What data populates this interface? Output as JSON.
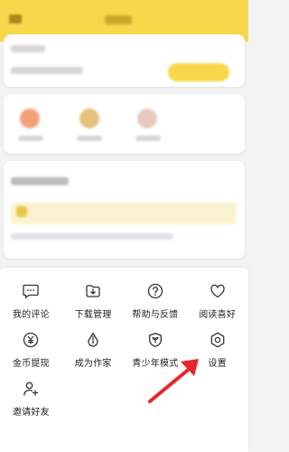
{
  "background_page": {
    "header_color": "#f8d84a",
    "blurred": true
  },
  "menu": {
    "items": [
      {
        "label": "我的评论",
        "icon": "comment-icon"
      },
      {
        "label": "下载管理",
        "icon": "download-icon"
      },
      {
        "label": "帮助与反馈",
        "icon": "help-icon"
      },
      {
        "label": "阅读喜好",
        "icon": "heart-icon"
      },
      {
        "label": "金币提现",
        "icon": "coin-withdraw-icon"
      },
      {
        "label": "成为作家",
        "icon": "pen-nib-icon"
      },
      {
        "label": "青少年模式",
        "icon": "sprout-shield-icon"
      },
      {
        "label": "设置",
        "icon": "gear-icon"
      },
      {
        "label": "邀请好友",
        "icon": "add-user-icon"
      }
    ]
  },
  "annotation": {
    "arrow_color": "#e8242c",
    "points_to": "设置"
  }
}
